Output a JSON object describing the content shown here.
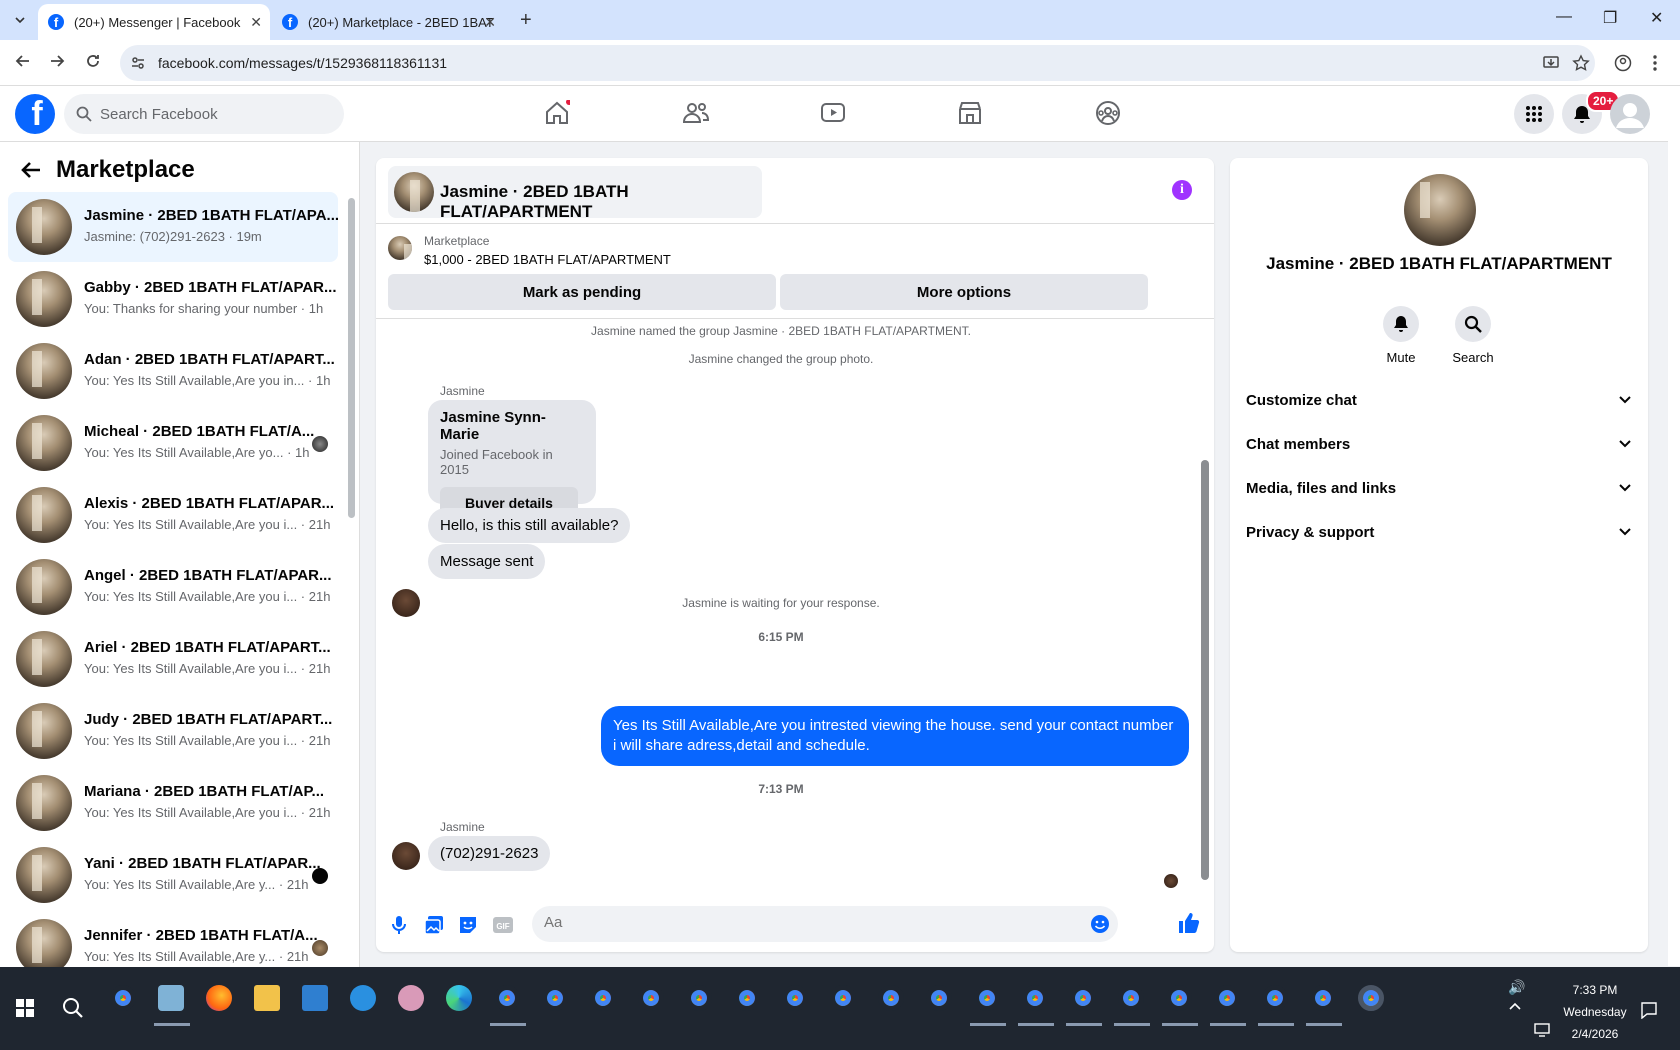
{
  "browser": {
    "tabs": [
      {
        "label": "(20+) Messenger | Facebook",
        "active": true
      },
      {
        "label": "(20+) Marketplace - 2BED 1BAT",
        "active": false
      }
    ],
    "url": "facebook.com/messages/t/1529368118361131"
  },
  "fb": {
    "search_placeholder": "Search Facebook",
    "notification_badge": "20+"
  },
  "left": {
    "title": "Marketplace",
    "conversations": [
      {
        "name": "Jasmine · 2BED 1BATH FLAT/APA...",
        "preview": "Jasmine: (702)291-2623 · 19m",
        "selected": true
      },
      {
        "name": "Gabby · 2BED 1BATH FLAT/APAR...",
        "preview": "You: Thanks for sharing your number · 1h"
      },
      {
        "name": "Adan · 2BED 1BATH FLAT/APART...",
        "preview": "You: Yes Its Still Available,Are you in... · 1h"
      },
      {
        "name": "Micheal · 2BED 1BATH FLAT/A...",
        "preview": "You: Yes Its Still Available,Are yo... · 1h"
      },
      {
        "name": "Alexis · 2BED 1BATH FLAT/APAR...",
        "preview": "You: Yes Its Still Available,Are you i... · 21h"
      },
      {
        "name": "Angel · 2BED 1BATH FLAT/APAR...",
        "preview": "You: Yes Its Still Available,Are you i... · 21h"
      },
      {
        "name": "Ariel · 2BED 1BATH FLAT/APART...",
        "preview": "You: Yes Its Still Available,Are you i... · 21h"
      },
      {
        "name": "Judy · 2BED 1BATH FLAT/APART...",
        "preview": "You: Yes Its Still Available,Are you i... · 21h"
      },
      {
        "name": "Mariana · 2BED 1BATH FLAT/AP...",
        "preview": "You: Yes Its Still Available,Are you i... · 21h"
      },
      {
        "name": "Yani · 2BED 1BATH FLAT/APAR...",
        "preview": "You: Yes Its Still Available,Are y... · 21h"
      },
      {
        "name": "Jennifer · 2BED 1BATH FLAT/A...",
        "preview": "You: Yes Its Still Available,Are y... · 21h"
      }
    ]
  },
  "chat": {
    "header_title": "Jasmine · 2BED 1BATH FLAT/APARTMENT",
    "listing_label": "Marketplace",
    "listing_title": "$1,000 - 2BED 1BATH FLAT/APARTMENT",
    "mark_pending": "Mark as pending",
    "more_options": "More options",
    "sys_named": "Jasmine named the group Jasmine · 2BED 1BATH FLAT/APARTMENT.",
    "sys_photo": "Jasmine changed the group photo.",
    "sender": "Jasmine",
    "card_name": "Jasmine Synn-Marie",
    "card_joined": "Joined Facebook in 2015",
    "buyer_details": "Buyer details",
    "msg_available": "Hello, is this still available?",
    "msg_sent": "Message sent",
    "sys_waiting": "Jasmine is waiting for your response.",
    "time1": "6:15 PM",
    "my_message": "Yes Its Still Available,Are you intrested viewing the house. send your contact number i will share adress,detail and schedule.",
    "time2": "7:13 PM",
    "msg_phone": "(702)291-2623",
    "input_placeholder": "Aa"
  },
  "right": {
    "name": "Jasmine · 2BED 1BATH FLAT/APARTMENT",
    "mute": "Mute",
    "search": "Search",
    "sections": [
      "Customize chat",
      "Chat members",
      "Media, files and links",
      "Privacy & support"
    ]
  },
  "taskbar": {
    "time": "7:33 PM",
    "day": "Wednesday",
    "date": "2/4/2026"
  },
  "colors": {
    "brand": "#0866ff",
    "info": "#a033ff",
    "badge": "#e41e3f"
  }
}
